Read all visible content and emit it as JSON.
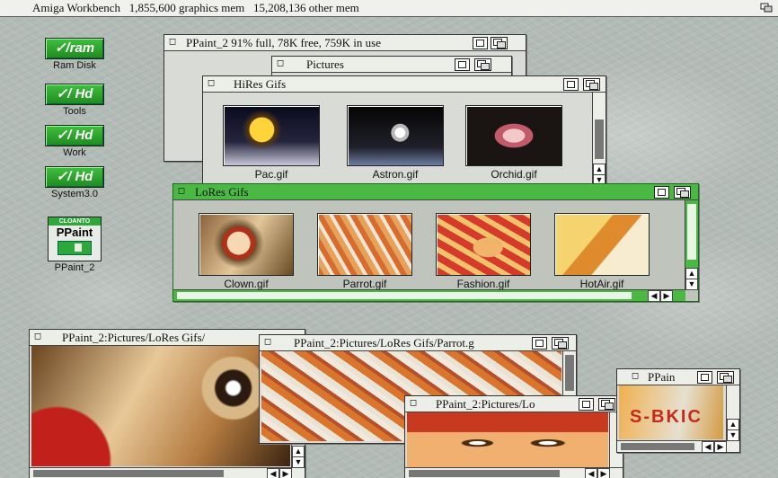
{
  "screen": {
    "title": "Amiga Workbench",
    "graphics_mem": "1,855,600 graphics mem",
    "other_mem": "15,208,136 other mem"
  },
  "icons": [
    {
      "name": "ram-icon",
      "label": "Ram Disk",
      "badge": "ram"
    },
    {
      "name": "tools-icon",
      "label": "Tools",
      "badge": "Hd"
    },
    {
      "name": "work-icon",
      "label": "Work",
      "badge": "Hd"
    },
    {
      "name": "system-icon",
      "label": "System3.0",
      "badge": "Hd"
    },
    {
      "name": "ppaint-icon",
      "label": "PPaint_2",
      "badge": "PPaint",
      "ribbon": "CLOANTO"
    }
  ],
  "windows": {
    "ppaint2": {
      "title": "PPaint_2  91% full, 78K free, 759K in use"
    },
    "pictures": {
      "title": "Pictures"
    },
    "hires": {
      "title": "HiRes Gifs",
      "items": [
        {
          "label": "Pac.gif",
          "icon": "pac-thumbnail"
        },
        {
          "label": "Astron.gif",
          "icon": "astronaut-thumbnail"
        },
        {
          "label": "Orchid.gif",
          "icon": "orchid-thumbnail"
        }
      ]
    },
    "lores": {
      "title": "LoRes Gifs",
      "items": [
        {
          "label": "Clown.gif",
          "icon": "clown-thumbnail"
        },
        {
          "label": "Parrot.gif",
          "icon": "parrot-thumbnail"
        },
        {
          "label": "Fashion.gif",
          "icon": "fashion-thumbnail"
        },
        {
          "label": "HotAir.gif",
          "icon": "hotair-thumbnail"
        }
      ]
    },
    "viewer_clown": {
      "title": "PPaint_2:Pictures/LoRes Gifs/"
    },
    "viewer_parrot": {
      "title": "PPaint_2:Pictures/LoRes Gifs/Parrot.g"
    },
    "viewer_fashion": {
      "title": "PPaint_2:Pictures/Lo"
    },
    "viewer_hotair": {
      "title": "PPain",
      "overlay_text": "S-BKIC"
    }
  },
  "colors": {
    "active_titlebar": "#49b943",
    "inactive_titlebar": "#eceee8",
    "drive_icon": "#2fa83a"
  }
}
